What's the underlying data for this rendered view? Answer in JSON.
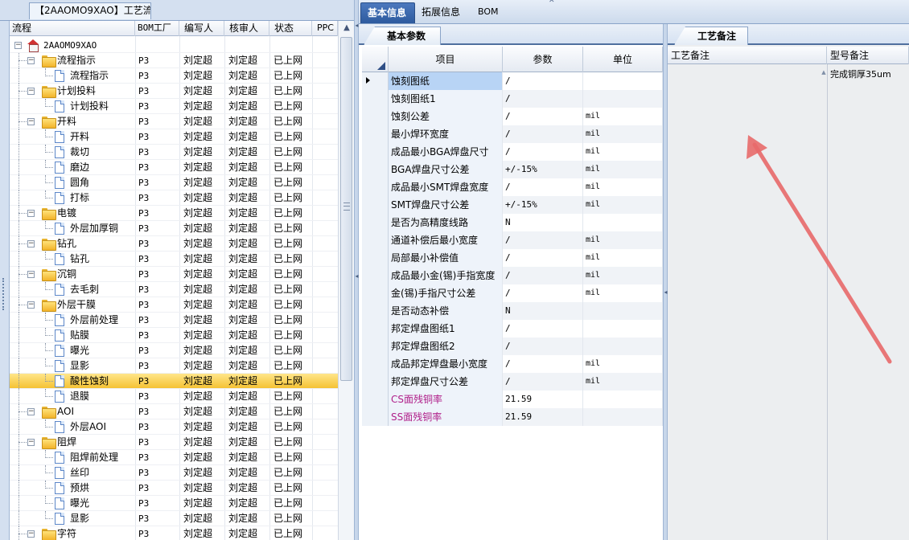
{
  "left_panel": {
    "title": "【2AAOMO9XAO】工艺流程",
    "columns": {
      "name": "流程",
      "bom_factory": "BOM工厂",
      "author": "编写人",
      "reviewer": "核审人",
      "status": "状态",
      "ppc": "PPC"
    },
    "scroll_up_glyph": "▲",
    "root_label": "2AAOMO9XAO",
    "rows": [
      {
        "label": "流程指示",
        "bom": "P3",
        "author": "刘定超",
        "reviewer": "刘定超",
        "status": "已上网"
      },
      {
        "label": "流程指示",
        "bom": "P3",
        "author": "刘定超",
        "reviewer": "刘定超",
        "status": "已上网"
      },
      {
        "label": "计划投料",
        "bom": "P3",
        "author": "刘定超",
        "reviewer": "刘定超",
        "status": "已上网"
      },
      {
        "label": "计划投料",
        "bom": "P3",
        "author": "刘定超",
        "reviewer": "刘定超",
        "status": "已上网"
      },
      {
        "label": "开料",
        "bom": "P3",
        "author": "刘定超",
        "reviewer": "刘定超",
        "status": "已上网"
      },
      {
        "label": "开料",
        "bom": "P3",
        "author": "刘定超",
        "reviewer": "刘定超",
        "status": "已上网"
      },
      {
        "label": "裁切",
        "bom": "P3",
        "author": "刘定超",
        "reviewer": "刘定超",
        "status": "已上网"
      },
      {
        "label": "磨边",
        "bom": "P3",
        "author": "刘定超",
        "reviewer": "刘定超",
        "status": "已上网"
      },
      {
        "label": "圆角",
        "bom": "P3",
        "author": "刘定超",
        "reviewer": "刘定超",
        "status": "已上网"
      },
      {
        "label": "打标",
        "bom": "P3",
        "author": "刘定超",
        "reviewer": "刘定超",
        "status": "已上网"
      },
      {
        "label": "电镀",
        "bom": "P3",
        "author": "刘定超",
        "reviewer": "刘定超",
        "status": "已上网"
      },
      {
        "label": "外层加厚铜",
        "bom": "P3",
        "author": "刘定超",
        "reviewer": "刘定超",
        "status": "已上网"
      },
      {
        "label": "钻孔",
        "bom": "P3",
        "author": "刘定超",
        "reviewer": "刘定超",
        "status": "已上网"
      },
      {
        "label": "钻孔",
        "bom": "P3",
        "author": "刘定超",
        "reviewer": "刘定超",
        "status": "已上网"
      },
      {
        "label": "沉铜",
        "bom": "P3",
        "author": "刘定超",
        "reviewer": "刘定超",
        "status": "已上网"
      },
      {
        "label": "去毛刺",
        "bom": "P3",
        "author": "刘定超",
        "reviewer": "刘定超",
        "status": "已上网"
      },
      {
        "label": "外层干膜",
        "bom": "P3",
        "author": "刘定超",
        "reviewer": "刘定超",
        "status": "已上网"
      },
      {
        "label": "外层前处理",
        "bom": "P3",
        "author": "刘定超",
        "reviewer": "刘定超",
        "status": "已上网"
      },
      {
        "label": "贴膜",
        "bom": "P3",
        "author": "刘定超",
        "reviewer": "刘定超",
        "status": "已上网"
      },
      {
        "label": "曝光",
        "bom": "P3",
        "author": "刘定超",
        "reviewer": "刘定超",
        "status": "已上网"
      },
      {
        "label": "显影",
        "bom": "P3",
        "author": "刘定超",
        "reviewer": "刘定超",
        "status": "已上网"
      },
      {
        "label": "酸性蚀刻",
        "bom": "P3",
        "author": "刘定超",
        "reviewer": "刘定超",
        "status": "已上网"
      },
      {
        "label": "退膜",
        "bom": "P3",
        "author": "刘定超",
        "reviewer": "刘定超",
        "status": "已上网"
      },
      {
        "label": "AOI",
        "bom": "P3",
        "author": "刘定超",
        "reviewer": "刘定超",
        "status": "已上网"
      },
      {
        "label": "外层AOI",
        "bom": "P3",
        "author": "刘定超",
        "reviewer": "刘定超",
        "status": "已上网"
      },
      {
        "label": "阻焊",
        "bom": "P3",
        "author": "刘定超",
        "reviewer": "刘定超",
        "status": "已上网"
      },
      {
        "label": "阻焊前处理",
        "bom": "P3",
        "author": "刘定超",
        "reviewer": "刘定超",
        "status": "已上网"
      },
      {
        "label": "丝印",
        "bom": "P3",
        "author": "刘定超",
        "reviewer": "刘定超",
        "status": "已上网"
      },
      {
        "label": "预烘",
        "bom": "P3",
        "author": "刘定超",
        "reviewer": "刘定超",
        "status": "已上网"
      },
      {
        "label": "曝光",
        "bom": "P3",
        "author": "刘定超",
        "reviewer": "刘定超",
        "status": "已上网"
      },
      {
        "label": "显影",
        "bom": "P3",
        "author": "刘定超",
        "reviewer": "刘定超",
        "status": "已上网"
      },
      {
        "label": "字符",
        "bom": "P3",
        "author": "刘定超",
        "reviewer": "刘定超",
        "status": "已上网"
      }
    ]
  },
  "top_tabs": {
    "basic": "基本信息",
    "extended": "拓展信息",
    "bom": "BOM",
    "close_glyph": "✕"
  },
  "basic_panel": {
    "tab_label": "基本参数",
    "columns": {
      "item": "项目",
      "param": "参数",
      "unit": "单位"
    },
    "rows": [
      {
        "item": "蚀刻图纸",
        "param": "/",
        "unit": ""
      },
      {
        "item": "蚀刻图纸1",
        "param": "/",
        "unit": ""
      },
      {
        "item": "蚀刻公差",
        "param": "/",
        "unit": "mil"
      },
      {
        "item": "最小焊环宽度",
        "param": "/",
        "unit": "mil"
      },
      {
        "item": "成品最小BGA焊盘尺寸",
        "param": "/",
        "unit": "mil"
      },
      {
        "item": "BGA焊盘尺寸公差",
        "param": "+/-15%",
        "unit": "mil"
      },
      {
        "item": "成品最小SMT焊盘宽度",
        "param": "/",
        "unit": "mil"
      },
      {
        "item": "SMT焊盘尺寸公差",
        "param": "+/-15%",
        "unit": "mil"
      },
      {
        "item": "是否为高精度线路",
        "param": "N",
        "unit": ""
      },
      {
        "item": "通道补偿后最小宽度",
        "param": "/",
        "unit": "mil"
      },
      {
        "item": "局部最小补偿值",
        "param": "/",
        "unit": "mil"
      },
      {
        "item": "成品最小金(锡)手指宽度",
        "param": "/",
        "unit": "mil"
      },
      {
        "item": "金(锡)手指尺寸公差",
        "param": "/",
        "unit": "mil"
      },
      {
        "item": "是否动态补偿",
        "param": "N",
        "unit": ""
      },
      {
        "item": "邦定焊盘图纸1",
        "param": "/",
        "unit": ""
      },
      {
        "item": "邦定焊盘图纸2",
        "param": "/",
        "unit": ""
      },
      {
        "item": "成品邦定焊盘最小宽度",
        "param": "/",
        "unit": "mil"
      },
      {
        "item": "邦定焊盘尺寸公差",
        "param": "/",
        "unit": "mil"
      },
      {
        "item": "CS面残铜率",
        "param": "21.59",
        "unit": ""
      },
      {
        "item": "SS面残铜率",
        "param": "21.59",
        "unit": ""
      }
    ]
  },
  "notes_panel": {
    "tab_label": "工艺备注",
    "process_note_header": "工艺备注",
    "model_note_header": "型号备注",
    "model_note_text": "完成铜厚35um",
    "scroll_up_glyph": "▲"
  },
  "colors": {
    "accent_blue": "#2d5a9e",
    "selected_row": "#f5c234",
    "annotation_arrow": "#e86a6a",
    "pink_text": "#b0208a"
  }
}
